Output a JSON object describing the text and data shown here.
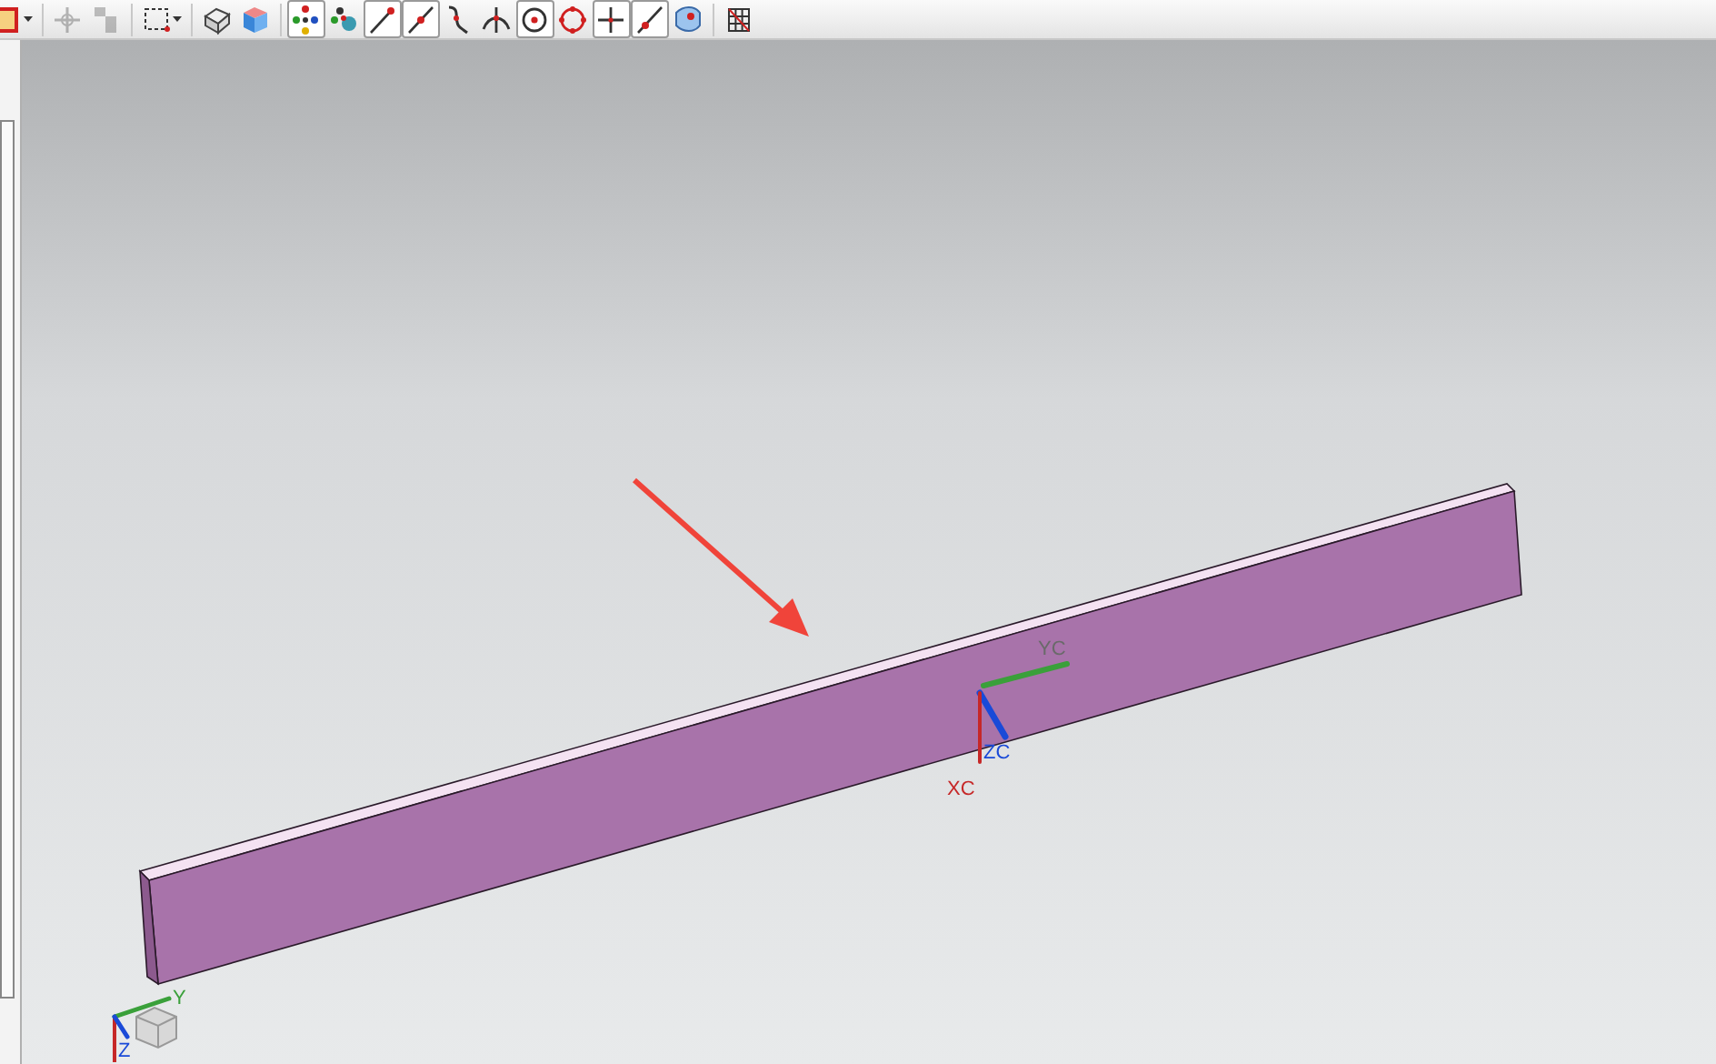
{
  "toolbar": {
    "buttons": [
      {
        "kind": "view-frame",
        "pressed": false,
        "disabled": false,
        "dropdown": true
      },
      {
        "kind": "transform",
        "pressed": false,
        "disabled": true,
        "dropdown": false
      },
      {
        "kind": "stack",
        "pressed": false,
        "disabled": true,
        "dropdown": false
      },
      {
        "kind": "select-box",
        "pressed": false,
        "disabled": false,
        "dropdown": true
      },
      {
        "kind": "shaded-edges",
        "pressed": false,
        "disabled": false,
        "dropdown": false
      },
      {
        "kind": "cube",
        "pressed": false,
        "disabled": false,
        "dropdown": false
      },
      {
        "kind": "snap-points",
        "pressed": true,
        "disabled": false,
        "dropdown": false
      },
      {
        "kind": "snap-settings",
        "pressed": false,
        "disabled": false,
        "dropdown": false
      },
      {
        "kind": "end-point",
        "pressed": true,
        "disabled": false,
        "dropdown": false
      },
      {
        "kind": "mid-point",
        "pressed": true,
        "disabled": false,
        "dropdown": false
      },
      {
        "kind": "control-curve",
        "pressed": false,
        "disabled": false,
        "dropdown": false
      },
      {
        "kind": "intersection",
        "pressed": false,
        "disabled": false,
        "dropdown": false
      },
      {
        "kind": "center",
        "pressed": true,
        "disabled": false,
        "dropdown": false
      },
      {
        "kind": "quadrant",
        "pressed": false,
        "disabled": false,
        "dropdown": false
      },
      {
        "kind": "existing-point",
        "pressed": true,
        "disabled": false,
        "dropdown": false
      },
      {
        "kind": "point-on-curve",
        "pressed": true,
        "disabled": false,
        "dropdown": false
      },
      {
        "kind": "point-on-face",
        "pressed": false,
        "disabled": false,
        "dropdown": false
      },
      {
        "kind": "grid",
        "pressed": false,
        "disabled": false,
        "dropdown": false
      }
    ]
  },
  "viewport": {
    "work_csys": {
      "axes": [
        {
          "kind": "y",
          "label": "YC"
        },
        {
          "kind": "z",
          "label": "ZC"
        },
        {
          "kind": "x",
          "label": "XC"
        }
      ]
    },
    "absolute_csys": {
      "axes": [
        {
          "kind": "y",
          "label": "Y"
        },
        {
          "kind": "z",
          "label": "Z"
        }
      ]
    }
  }
}
